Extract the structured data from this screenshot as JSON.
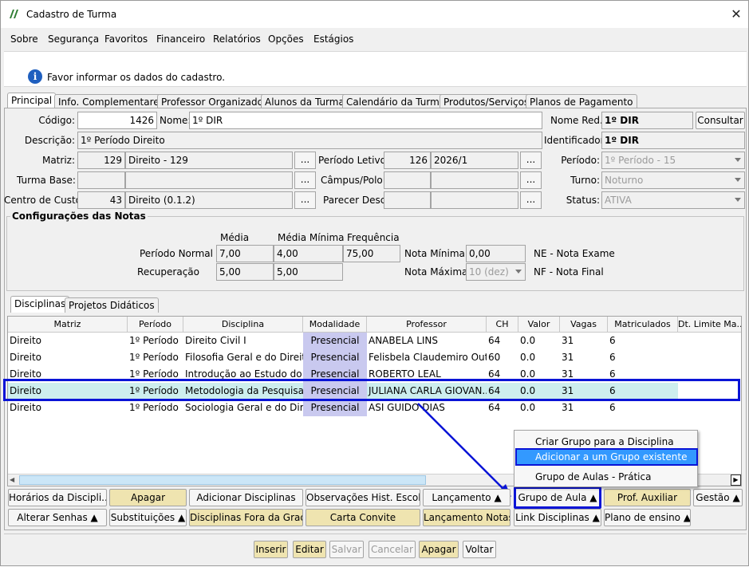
{
  "window": {
    "title": "Cadastro de Turma",
    "close": "✕"
  },
  "menu": [
    "Sobre",
    "Segurança",
    "Favoritos",
    "Financeiro",
    "Relatórios",
    "Opções",
    "Estágios"
  ],
  "info": {
    "icon": "i",
    "text": "Favor informar os dados do cadastro."
  },
  "tabs": [
    "Principal",
    "Info. Complementares",
    "Professor Organizador",
    "Alunos da Turma",
    "Calendário da Turma",
    "Produtos/Serviços",
    "Planos de Pagamento"
  ],
  "form": {
    "codigo_label": "Código:",
    "codigo": "1426",
    "nome_label": "Nome:",
    "nome": "1º DIR",
    "nome_red_label": "Nome Red.:",
    "nome_red": "1º DIR",
    "consultar": "Consultar",
    "descricao_label": "Descrição:",
    "descricao": "1º Período Direito",
    "identificador_label": "Identificador:",
    "identificador": "1º DIR",
    "matriz_label": "Matriz:",
    "matriz_code": "129",
    "matriz_name": "Direito - 129",
    "periodo_letivo_label": "Período Letivo:",
    "periodo_letivo_code": "126",
    "periodo_letivo": "2026/1",
    "periodo_label": "Período:",
    "periodo": "1º Período - 15",
    "turma_base_label": "Turma Base:",
    "campus_label": "Câmpus/Polo:",
    "turno_label": "Turno:",
    "turno": "Noturno",
    "centro_custo_label": "Centro de Custo:",
    "centro_custo_code": "43",
    "centro_custo": "Direito (0.1.2)",
    "parecer_label": "Parecer Desc.:",
    "status_label": "Status:",
    "status": "ATIVA",
    "ellipsis": "..."
  },
  "notas": {
    "title": "Configurações das Notas",
    "col_media": "Média",
    "col_media_min": "Média Mínima",
    "col_freq": "Frequência",
    "periodo_normal_label": "Período Normal",
    "pn_media": "7,00",
    "pn_media_min": "4,00",
    "pn_freq": "75,00",
    "recuperacao_label": "Recuperação",
    "rec_media": "5,00",
    "rec_media_min": "5,00",
    "nota_minima_label": "Nota Mínima",
    "nota_minima": "0,00",
    "nota_maxima_label": "Nota Máxima",
    "nota_maxima": "10 (dez)",
    "ne_label": "NE - Nota Exame",
    "nf_label": "NF - Nota Final"
  },
  "subtabs": [
    "Disciplinas",
    "Projetos Didáticos"
  ],
  "grid": {
    "columns": [
      "Matriz",
      "Período",
      "Disciplina",
      "Modalidade",
      "Professor",
      "CH",
      "Valor",
      "Vagas",
      "Matriculados",
      "Dt. Limite Ma..."
    ],
    "rows": [
      [
        "Direito",
        "1º Período",
        "Direito Civil I",
        "Presencial",
        "ANABELA LINS",
        "64",
        "0.0",
        "31",
        "6"
      ],
      [
        "Direito",
        "1º Período",
        "Filosofia Geral e do Direito",
        "Presencial",
        "Felisbela Claudemiro Out...",
        "60",
        "0.0",
        "31",
        "6"
      ],
      [
        "Direito",
        "1º Período",
        "Introdução ao Estudo do Dir",
        "Presencial",
        "ROBERTO LEAL",
        "64",
        "0.0",
        "31",
        "6"
      ],
      [
        "Direito",
        "1º Período",
        "Metodologia da Pesquisa",
        "Presencial",
        "JULIANA CARLA GIOVAN...",
        "64",
        "0.0",
        "31",
        "6"
      ],
      [
        "Direito",
        "1º Período",
        "Sociologia Geral e do Direito",
        "Presencial",
        "ASI GUIDO DIAS",
        "64",
        "0.0",
        "31",
        "6"
      ]
    ],
    "selected_row": 3
  },
  "popup": [
    "Criar Grupo para a Disciplina",
    "Adicionar a um Grupo existente",
    "Grupo de Aulas - Prática"
  ],
  "buttons_row1": [
    "Horários da Discipli...",
    "Apagar",
    "Adicionar Disciplinas",
    "Observações Hist. Escolar",
    "Lançamento ▲",
    "Grupo de Aula ▲",
    "Prof. Auxiliar",
    "Gestão ▲"
  ],
  "buttons_row2": [
    "Alterar Senhas ▲",
    "Substituições ▲",
    "Disciplinas Fora da Grade",
    "Carta Convite",
    "Lançamento Notas",
    "Link Disciplinas ▲",
    "Plano de ensino ▲"
  ],
  "footer": [
    "Inserir",
    "Editar",
    "Salvar",
    "Cancelar",
    "Apagar",
    "Voltar"
  ],
  "colors": {
    "selected_row": "#cdeeee",
    "modalidade": "#c9c9ef",
    "highlight": "#0a14d6",
    "yellow_btn": "#efe4b0"
  }
}
